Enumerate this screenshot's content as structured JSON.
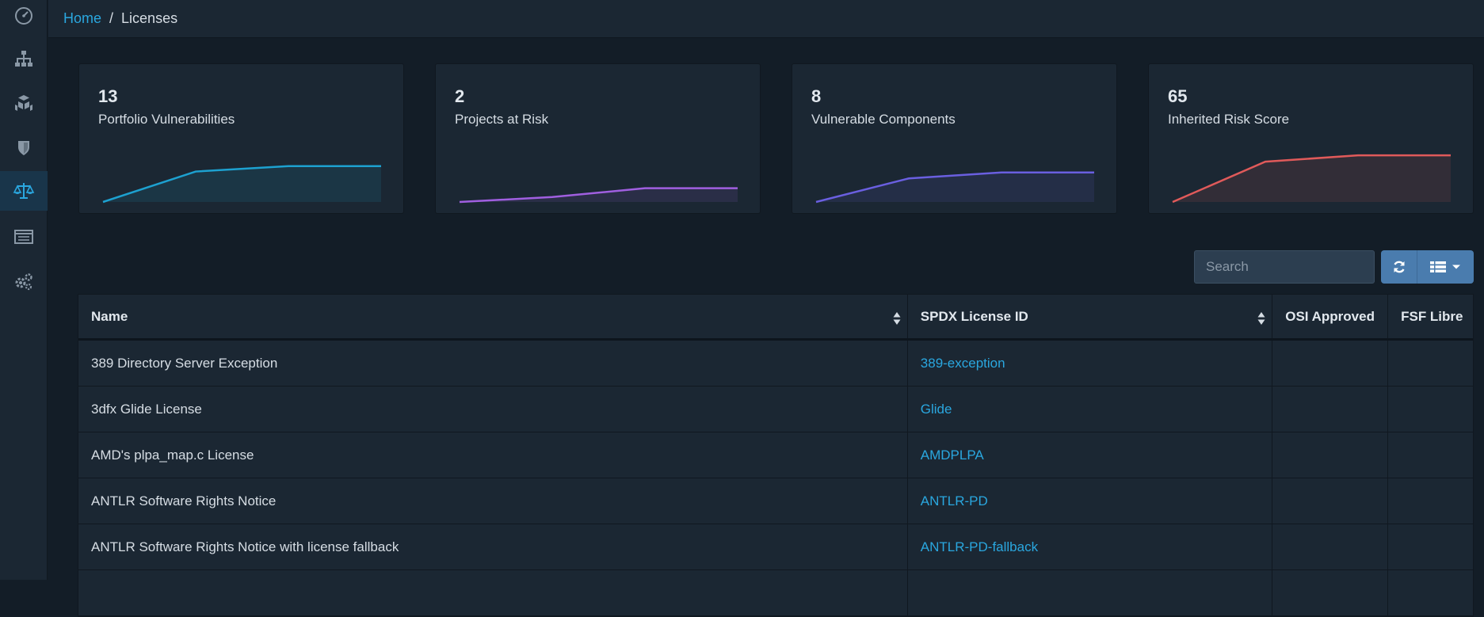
{
  "breadcrumb": {
    "home": "Home",
    "separator": "/",
    "current": "Licenses"
  },
  "sidebar": {
    "items": [
      {
        "icon": "dashboard-icon"
      },
      {
        "icon": "projects-icon"
      },
      {
        "icon": "components-icon"
      },
      {
        "icon": "vulnerabilities-icon"
      },
      {
        "icon": "licenses-icon",
        "active": true
      },
      {
        "icon": "policy-icon"
      },
      {
        "icon": "admin-icon"
      }
    ]
  },
  "cards": [
    {
      "value": "13",
      "label": "Portfolio Vulnerabilities",
      "color": "#1da1d0",
      "trend": [
        0,
        0.62,
        0.73,
        0.73
      ]
    },
    {
      "value": "2",
      "label": "Projects at Risk",
      "color": "#a05fe0",
      "trend": [
        0,
        0.1,
        0.28,
        0.28
      ]
    },
    {
      "value": "8",
      "label": "Vulnerable Components",
      "color": "#6a5fe0",
      "trend": [
        0,
        0.48,
        0.6,
        0.6
      ]
    },
    {
      "value": "65",
      "label": "Inherited Risk Score",
      "color": "#e05a5a",
      "trend": [
        0,
        0.82,
        0.95,
        0.95
      ]
    }
  ],
  "toolbar": {
    "search_placeholder": "Search"
  },
  "table": {
    "headers": [
      "Name",
      "SPDX License ID",
      "OSI Approved",
      "FSF Libre"
    ],
    "rows": [
      {
        "name": "389 Directory Server Exception",
        "id": "389-exception"
      },
      {
        "name": "3dfx Glide License",
        "id": "Glide"
      },
      {
        "name": "AMD's plpa_map.c License",
        "id": "AMDPLPA"
      },
      {
        "name": "ANTLR Software Rights Notice",
        "id": "ANTLR-PD"
      },
      {
        "name": "ANTLR Software Rights Notice with license fallback",
        "id": "ANTLR-PD-fallback"
      }
    ]
  }
}
